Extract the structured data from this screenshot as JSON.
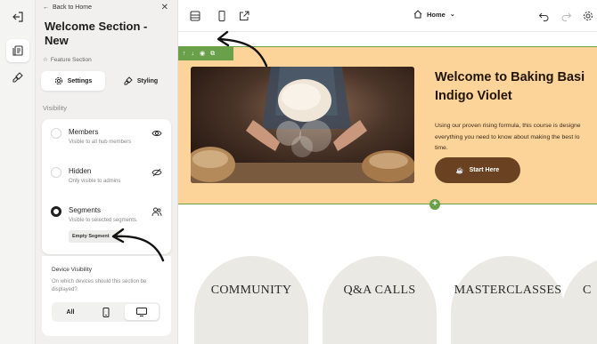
{
  "panel": {
    "back_label": "Back to Home",
    "title": "Welcome Section - New",
    "feature_tag": "Feature Section",
    "tabs": [
      {
        "label": "Settings",
        "icon": "gear-icon",
        "active": true
      },
      {
        "label": "Styling",
        "icon": "brush-icon",
        "active": false
      }
    ],
    "visibility_label": "Visibility",
    "options": [
      {
        "title": "Members",
        "subtitle": "Visible to all hub members",
        "icon": "eye-icon",
        "selected": false
      },
      {
        "title": "Hidden",
        "subtitle": "Only visible to admins",
        "icon": "eye-off-icon",
        "selected": false
      },
      {
        "title": "Segments",
        "subtitle": "Visible to selected segments.",
        "icon": "users-icon",
        "selected": true
      }
    ],
    "segment_chip": "Empty Segment",
    "device_visibility": {
      "title": "Device Visibility",
      "description": "On which devices should this section be displayed?",
      "options": [
        {
          "label": "All",
          "icon": "",
          "active": false
        },
        {
          "label": "",
          "icon": "mobile-icon",
          "active": false
        },
        {
          "label": "",
          "icon": "desktop-icon",
          "active": true
        }
      ]
    }
  },
  "toolbar": {
    "page_name": "Home"
  },
  "hero": {
    "title": "Welcome to Baking Basi\nIndigo Violet",
    "body": "Using our proven rising formula, this course is designe\neverything you need to know about making the best lo\ntime.",
    "button_label": "Start Here",
    "toolbar_icons": [
      "↑",
      "↓",
      "◉",
      "⧉"
    ]
  },
  "categories": [
    "COMMUNITY",
    "Q&A CALLS",
    "MASTERCLASSES",
    "C"
  ],
  "colors": {
    "hero_bg": "#fcd49a",
    "accent_green": "#6aa04a",
    "button_brown": "#6a4222",
    "arch_bg": "#ebe9e3"
  }
}
